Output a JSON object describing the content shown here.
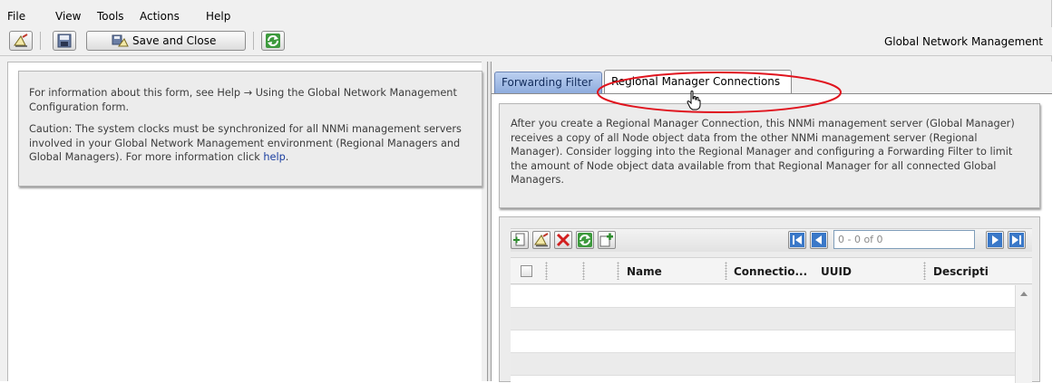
{
  "menu": [
    "File",
    "View",
    "Tools",
    "Actions",
    "Help"
  ],
  "toolbar": {
    "save_close_label": "Save and Close",
    "app_title": "Global Network Management"
  },
  "left_info": {
    "line1_prefix": "For information about this form, see Help ",
    "arrow": "→",
    "line1_suffix": " Using the Global Network Management Configuration form.",
    "caution": "Caution: The system clocks must be synchronized for all NNMi management servers involved in your Global Network Management environment (Regional Managers and Global Managers). For more information click ",
    "link_text": "help",
    "caution_end": "."
  },
  "tabs": [
    {
      "label": "Forwarding Filter",
      "active": false
    },
    {
      "label": "Regional Manager Connections",
      "active": true
    }
  ],
  "description": "After you create a Regional Manager Connection, this NNMi management server (Global Manager) receives a copy of all Node object data from the other NNMi management server (Regional Manager). Consider logging into the Regional Manager and configuring a Forwarding Filter to limit the amount of Node object data available from that Regional Manager for all connected Global Managers.",
  "table": {
    "pager_value": "0 - 0 of 0",
    "columns": [
      "Name",
      "Connectio...",
      "UUID",
      "Descripti"
    ],
    "rows": []
  },
  "icons": {
    "toolbar": [
      "edit-icon",
      "save-icon",
      "save-close-icon",
      "refresh-icon"
    ],
    "table_toolbar": [
      "new-icon",
      "open-icon",
      "delete-icon",
      "refresh-icon",
      "add-icon",
      "first-page-icon",
      "previous-page-icon",
      "next-page-icon",
      "last-page-icon"
    ]
  },
  "colors": {
    "annotation_ellipse": "#e0141e",
    "active_tab_bg": "#ffffff",
    "inactive_tab_bg": "#a7bfe6",
    "link": "#1a3ea0"
  }
}
